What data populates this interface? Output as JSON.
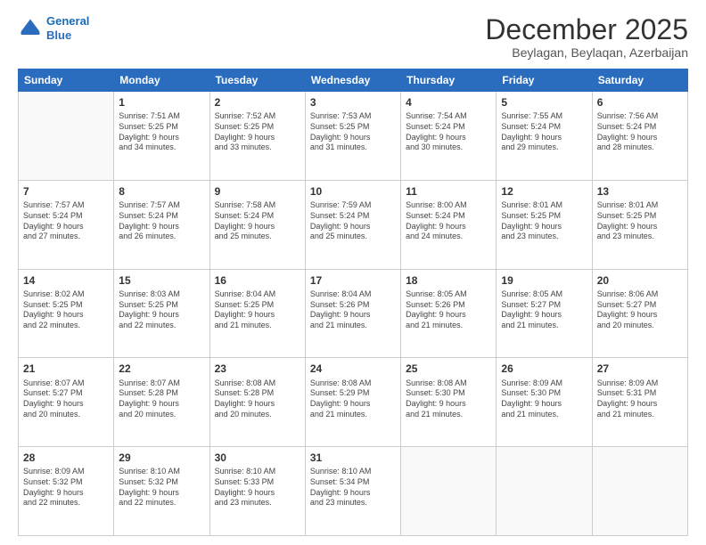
{
  "header": {
    "logo_line1": "General",
    "logo_line2": "Blue",
    "month_title": "December 2025",
    "location": "Beylagan, Beylaqan, Azerbaijan"
  },
  "days_of_week": [
    "Sunday",
    "Monday",
    "Tuesday",
    "Wednesday",
    "Thursday",
    "Friday",
    "Saturday"
  ],
  "weeks": [
    [
      {
        "day": "",
        "info": ""
      },
      {
        "day": "1",
        "info": "Sunrise: 7:51 AM\nSunset: 5:25 PM\nDaylight: 9 hours\nand 34 minutes."
      },
      {
        "day": "2",
        "info": "Sunrise: 7:52 AM\nSunset: 5:25 PM\nDaylight: 9 hours\nand 33 minutes."
      },
      {
        "day": "3",
        "info": "Sunrise: 7:53 AM\nSunset: 5:25 PM\nDaylight: 9 hours\nand 31 minutes."
      },
      {
        "day": "4",
        "info": "Sunrise: 7:54 AM\nSunset: 5:24 PM\nDaylight: 9 hours\nand 30 minutes."
      },
      {
        "day": "5",
        "info": "Sunrise: 7:55 AM\nSunset: 5:24 PM\nDaylight: 9 hours\nand 29 minutes."
      },
      {
        "day": "6",
        "info": "Sunrise: 7:56 AM\nSunset: 5:24 PM\nDaylight: 9 hours\nand 28 minutes."
      }
    ],
    [
      {
        "day": "7",
        "info": "Sunrise: 7:57 AM\nSunset: 5:24 PM\nDaylight: 9 hours\nand 27 minutes."
      },
      {
        "day": "8",
        "info": "Sunrise: 7:57 AM\nSunset: 5:24 PM\nDaylight: 9 hours\nand 26 minutes."
      },
      {
        "day": "9",
        "info": "Sunrise: 7:58 AM\nSunset: 5:24 PM\nDaylight: 9 hours\nand 25 minutes."
      },
      {
        "day": "10",
        "info": "Sunrise: 7:59 AM\nSunset: 5:24 PM\nDaylight: 9 hours\nand 25 minutes."
      },
      {
        "day": "11",
        "info": "Sunrise: 8:00 AM\nSunset: 5:24 PM\nDaylight: 9 hours\nand 24 minutes."
      },
      {
        "day": "12",
        "info": "Sunrise: 8:01 AM\nSunset: 5:25 PM\nDaylight: 9 hours\nand 23 minutes."
      },
      {
        "day": "13",
        "info": "Sunrise: 8:01 AM\nSunset: 5:25 PM\nDaylight: 9 hours\nand 23 minutes."
      }
    ],
    [
      {
        "day": "14",
        "info": "Sunrise: 8:02 AM\nSunset: 5:25 PM\nDaylight: 9 hours\nand 22 minutes."
      },
      {
        "day": "15",
        "info": "Sunrise: 8:03 AM\nSunset: 5:25 PM\nDaylight: 9 hours\nand 22 minutes."
      },
      {
        "day": "16",
        "info": "Sunrise: 8:04 AM\nSunset: 5:25 PM\nDaylight: 9 hours\nand 21 minutes."
      },
      {
        "day": "17",
        "info": "Sunrise: 8:04 AM\nSunset: 5:26 PM\nDaylight: 9 hours\nand 21 minutes."
      },
      {
        "day": "18",
        "info": "Sunrise: 8:05 AM\nSunset: 5:26 PM\nDaylight: 9 hours\nand 21 minutes."
      },
      {
        "day": "19",
        "info": "Sunrise: 8:05 AM\nSunset: 5:27 PM\nDaylight: 9 hours\nand 21 minutes."
      },
      {
        "day": "20",
        "info": "Sunrise: 8:06 AM\nSunset: 5:27 PM\nDaylight: 9 hours\nand 20 minutes."
      }
    ],
    [
      {
        "day": "21",
        "info": "Sunrise: 8:07 AM\nSunset: 5:27 PM\nDaylight: 9 hours\nand 20 minutes."
      },
      {
        "day": "22",
        "info": "Sunrise: 8:07 AM\nSunset: 5:28 PM\nDaylight: 9 hours\nand 20 minutes."
      },
      {
        "day": "23",
        "info": "Sunrise: 8:08 AM\nSunset: 5:28 PM\nDaylight: 9 hours\nand 20 minutes."
      },
      {
        "day": "24",
        "info": "Sunrise: 8:08 AM\nSunset: 5:29 PM\nDaylight: 9 hours\nand 21 minutes."
      },
      {
        "day": "25",
        "info": "Sunrise: 8:08 AM\nSunset: 5:30 PM\nDaylight: 9 hours\nand 21 minutes."
      },
      {
        "day": "26",
        "info": "Sunrise: 8:09 AM\nSunset: 5:30 PM\nDaylight: 9 hours\nand 21 minutes."
      },
      {
        "day": "27",
        "info": "Sunrise: 8:09 AM\nSunset: 5:31 PM\nDaylight: 9 hours\nand 21 minutes."
      }
    ],
    [
      {
        "day": "28",
        "info": "Sunrise: 8:09 AM\nSunset: 5:32 PM\nDaylight: 9 hours\nand 22 minutes."
      },
      {
        "day": "29",
        "info": "Sunrise: 8:10 AM\nSunset: 5:32 PM\nDaylight: 9 hours\nand 22 minutes."
      },
      {
        "day": "30",
        "info": "Sunrise: 8:10 AM\nSunset: 5:33 PM\nDaylight: 9 hours\nand 23 minutes."
      },
      {
        "day": "31",
        "info": "Sunrise: 8:10 AM\nSunset: 5:34 PM\nDaylight: 9 hours\nand 23 minutes."
      },
      {
        "day": "",
        "info": ""
      },
      {
        "day": "",
        "info": ""
      },
      {
        "day": "",
        "info": ""
      }
    ]
  ]
}
